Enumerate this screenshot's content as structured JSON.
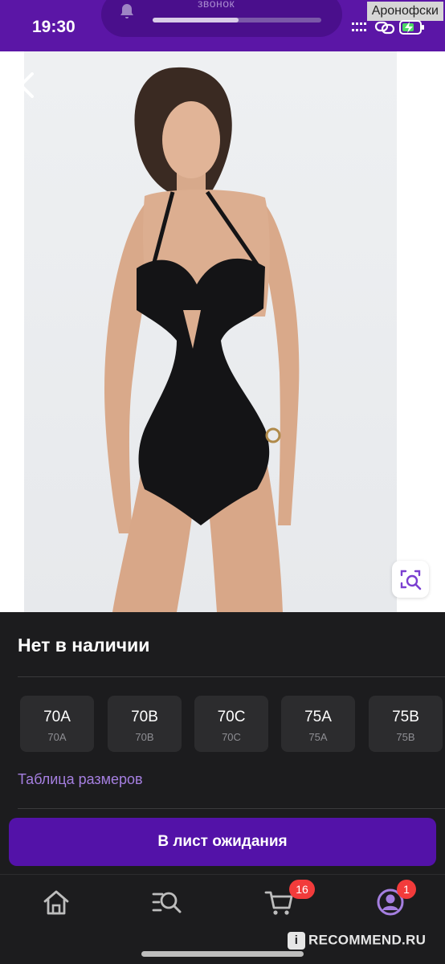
{
  "status_bar": {
    "time": "19:30",
    "call_label": "звонок",
    "call_progress": 0.51,
    "carrier": "Аронофски",
    "icons": [
      "signal-icon",
      "link-icon",
      "battery-charging-icon"
    ]
  },
  "hero": {
    "back_icon": "chevron-left-icon",
    "share_icon": "share-icon",
    "visual_search_icon": "image-search-icon",
    "photo": "model-in-black-swimsuit"
  },
  "product": {
    "stock_status": "Нет в наличии",
    "sizes": [
      {
        "label": "70A",
        "sub": "70A"
      },
      {
        "label": "70B",
        "sub": "70B"
      },
      {
        "label": "70C",
        "sub": "70C"
      },
      {
        "label": "75A",
        "sub": "75A"
      },
      {
        "label": "75B",
        "sub": "75B"
      }
    ],
    "size_table_link": "Таблица размеров",
    "waitlist_button": "В лист ожидания"
  },
  "nav": {
    "items": [
      {
        "name": "home",
        "icon": "home-icon"
      },
      {
        "name": "catalog-search",
        "icon": "search-list-icon"
      },
      {
        "name": "cart",
        "icon": "cart-icon",
        "badge": "16"
      },
      {
        "name": "profile",
        "icon": "profile-icon",
        "badge": "1"
      }
    ]
  },
  "watermark": "RECOMMEND.RU",
  "colors": {
    "brand": "#5b16a6",
    "button": "#5312a8",
    "link": "#a57fe0",
    "badge": "#f23b3b",
    "sheet_bg": "#1c1c1e"
  }
}
